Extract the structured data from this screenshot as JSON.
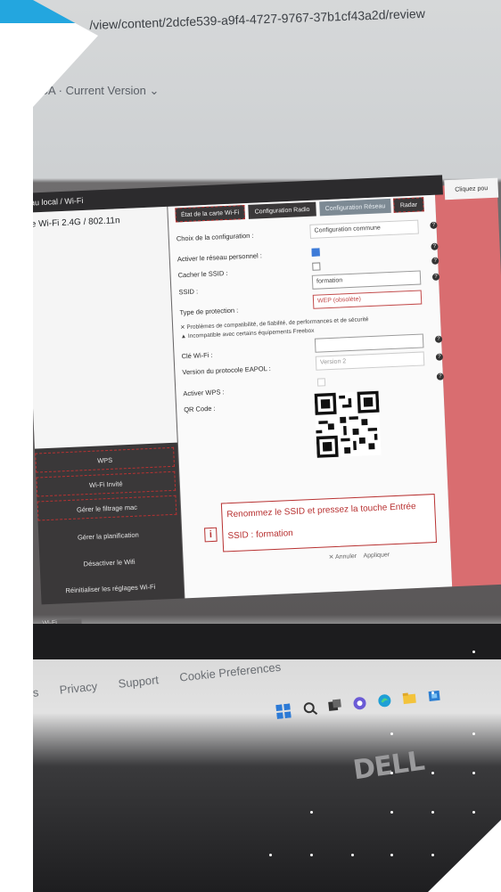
{
  "browser": {
    "url": "/view/content/2dcfe539-a9f4-4727-9767-37b1cf43a2d/review",
    "breadcrumb": "ACA · Current Version ⌄"
  },
  "dialog": {
    "title": "eau local / Wi-Fi",
    "sidebar": {
      "selected_item": "te Wi-Fi 2.4G / 802.11n",
      "buttons": [
        "WPS",
        "Wi-Fi Invité",
        "Gérer le filtrage mac",
        "Gérer la planification",
        "Désactiver le Wifi",
        "Réinitialiser les réglages Wi-Fi"
      ]
    },
    "tabs": [
      "État de la carte Wi-Fi",
      "Configuration Radio",
      "Configuration Réseau",
      "Radar"
    ],
    "active_tab": "Configuration Réseau",
    "form": {
      "config_choice_label": "Choix de la configuration :",
      "config_choice_value": "Configuration commune",
      "enable_personal_label": "Activer le réseau personnel :",
      "hide_ssid_label": "Cacher le SSID :",
      "ssid_label": "SSID :",
      "ssid_value": "formation",
      "protection_label": "Type de protection :",
      "protection_value": "WEP (obsolète)",
      "warning_1": "Problèmes de compatibilité, de fiabilité, de performances et de sécurité",
      "warning_2": "Incompatible avec certains équipements Freebox",
      "wifi_key_label": "Clé Wi-Fi :",
      "eapol_label": "Version du protocole EAPOL :",
      "eapol_value": "Version 2",
      "wps_label": "Activer WPS :",
      "qr_label": "QR Code :"
    },
    "tooltip": {
      "text": "Renommez le SSID et pressez la touche Entrée",
      "ssid_line": "SSID : formation"
    },
    "footer": {
      "cancel": "✕ Annuler",
      "apply": "Appliquer"
    }
  },
  "right_panel": {
    "tab_label": "Cliquez pou"
  },
  "taskbar_window": "Wi-Fi",
  "page_footer": {
    "links": [
      "s",
      "Privacy",
      "Support",
      "Cookie Preferences"
    ]
  },
  "monitor": {
    "brand": "DELL"
  },
  "colors": {
    "banner": "#23a6df",
    "accent_red": "#b83232",
    "pink": "#d96d70"
  }
}
